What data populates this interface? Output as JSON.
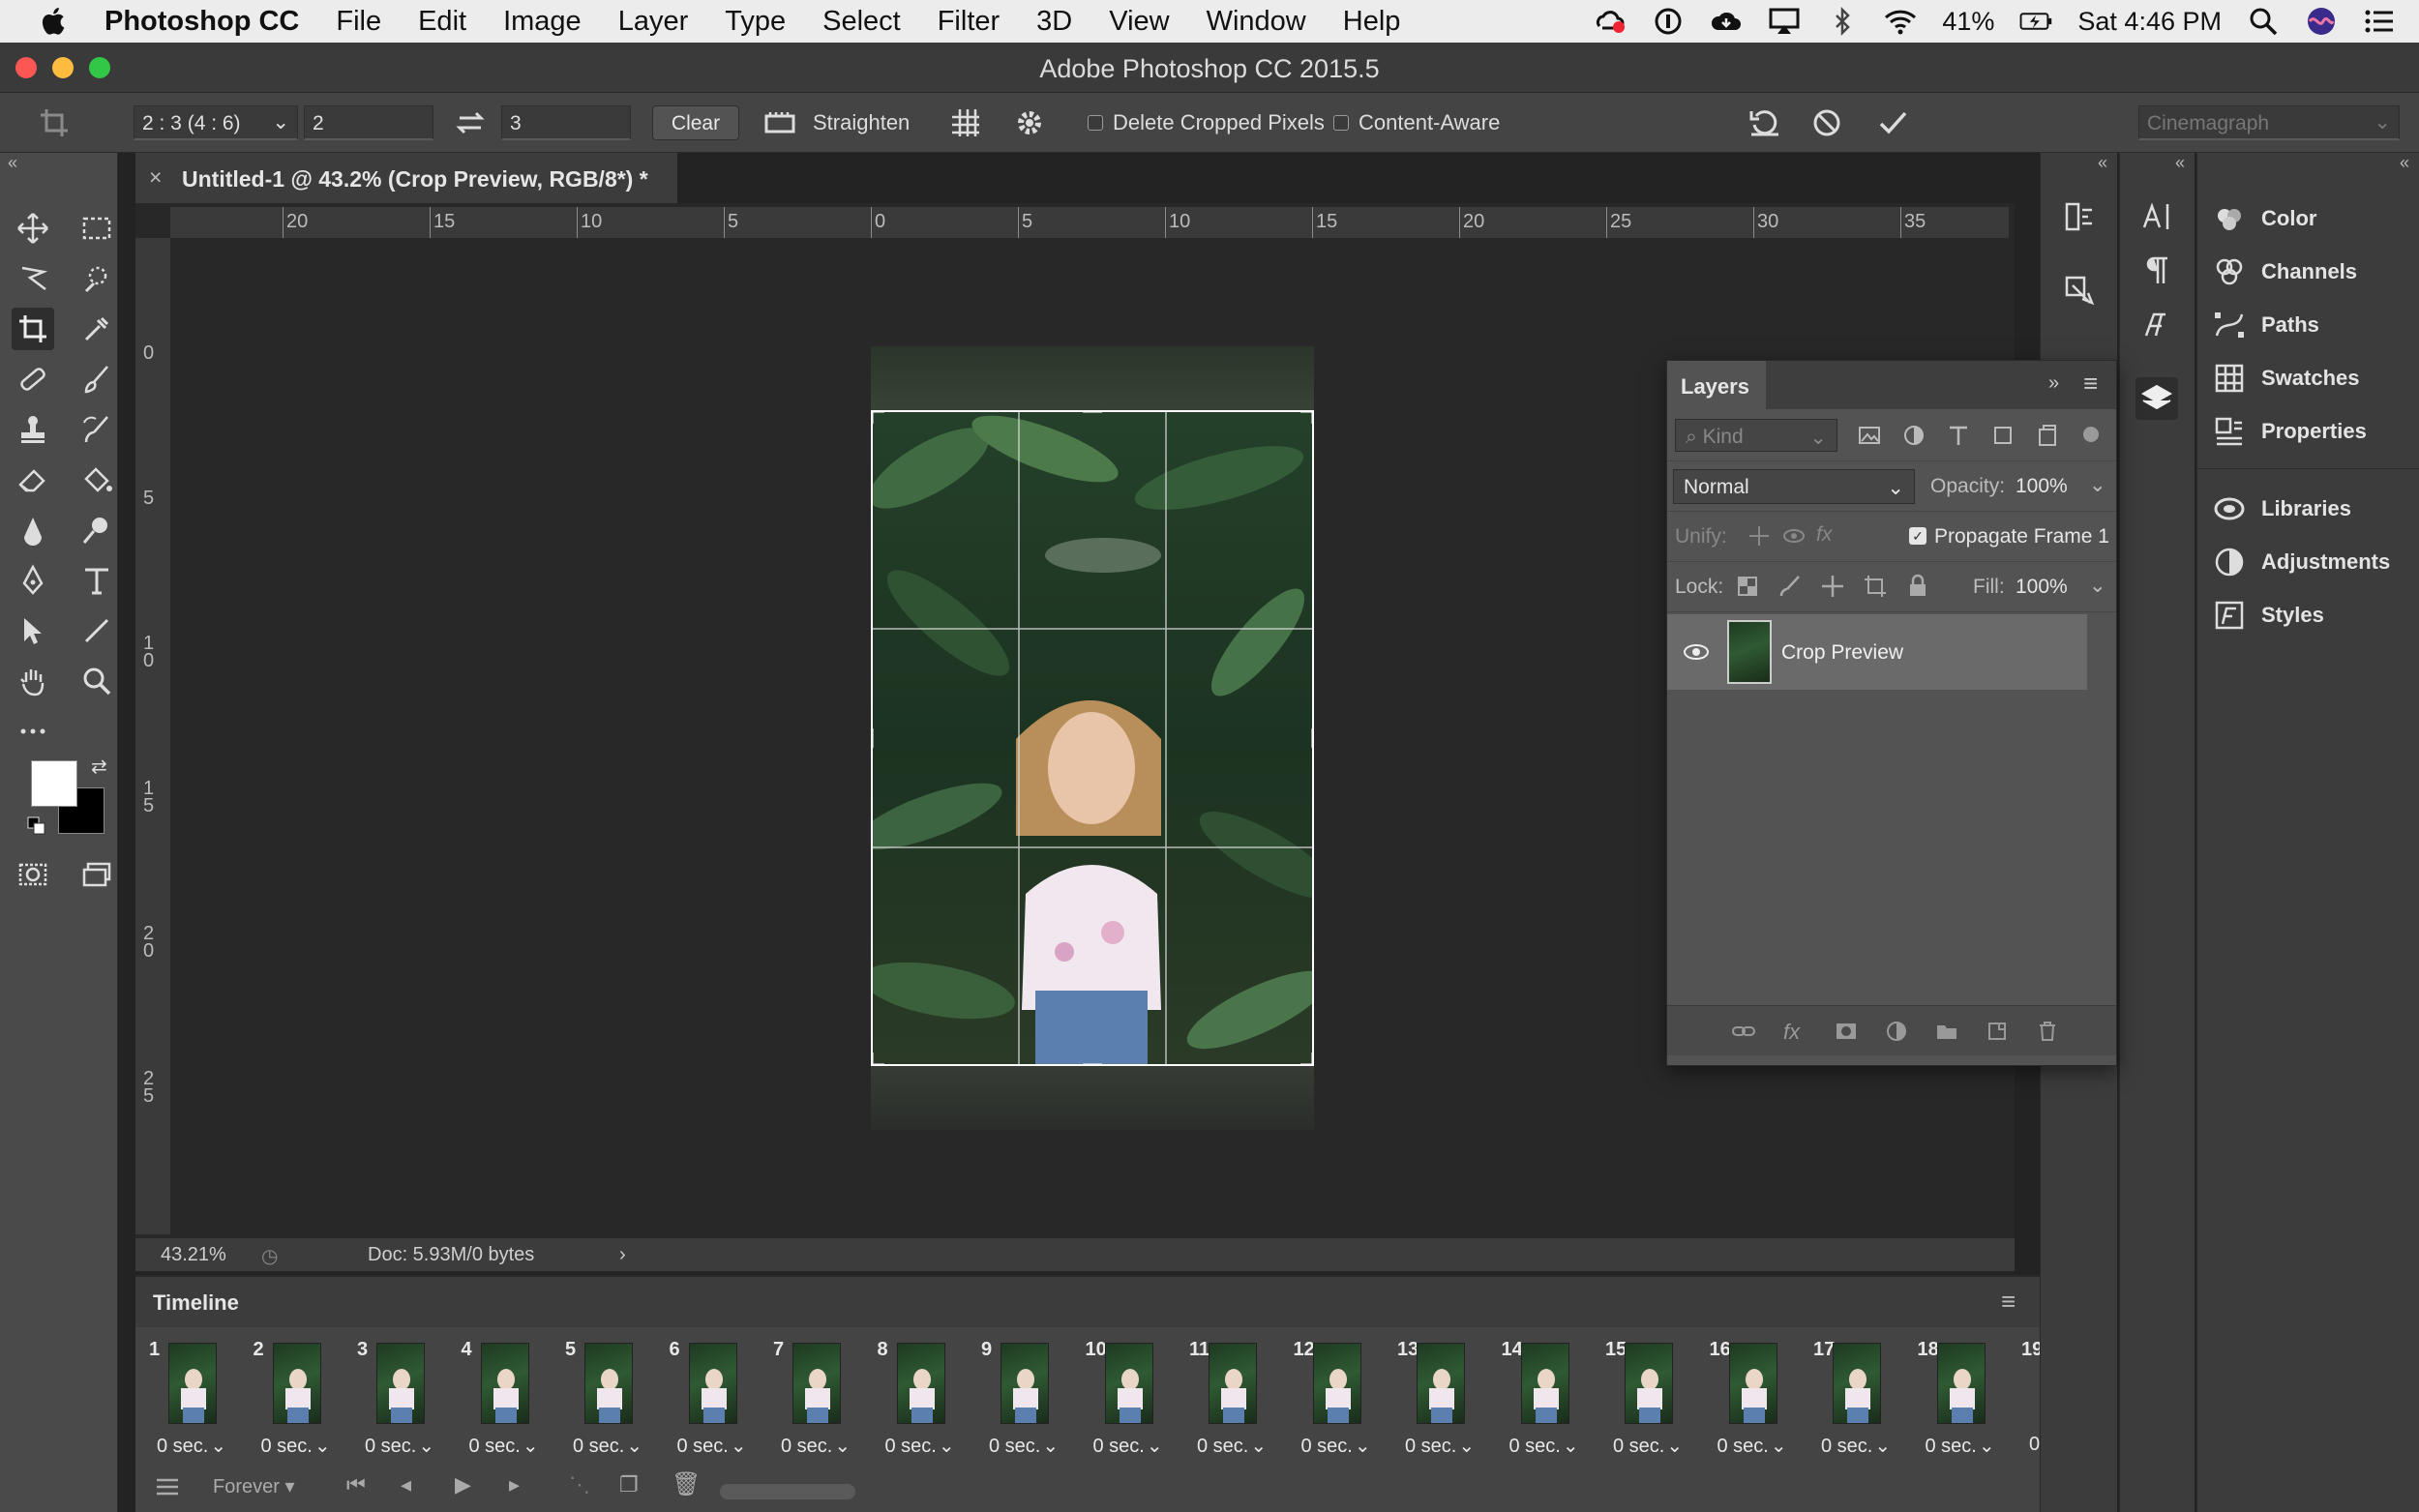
{
  "menubar": {
    "app_name": "Photoshop CC",
    "items": [
      "File",
      "Edit",
      "Image",
      "Layer",
      "Type",
      "Select",
      "Filter",
      "3D",
      "View",
      "Window",
      "Help"
    ],
    "battery": "41%",
    "clock": "Sat 4:46 PM"
  },
  "window": {
    "title": "Adobe Photoshop CC 2015.5"
  },
  "options": {
    "ratio": "2 : 3 (4 : 6)",
    "width_value": "2",
    "height_value": "3",
    "clear_label": "Clear",
    "straighten_label": "Straighten",
    "delete_cropped_label": "Delete Cropped Pixels",
    "content_aware_label": "Content-Aware",
    "workspace": "Cinemagraph"
  },
  "document": {
    "tab_title": "Untitled-1 @ 43.2% (Crop Preview, RGB/8*) *",
    "zoom": "43.21%",
    "doc_info": "Doc: 5.93M/0 bytes"
  },
  "rulers": {
    "top_ticks": [
      "20",
      "15",
      "10",
      "5",
      "0",
      "5",
      "10",
      "15",
      "20",
      "25",
      "30",
      "35"
    ],
    "left_ticks": [
      "0",
      "5",
      "10",
      "15",
      "20",
      "25"
    ]
  },
  "layers_panel": {
    "tab_label": "Layers",
    "kind_placeholder": "Kind",
    "blend_mode": "Normal",
    "opacity_label": "Opacity:",
    "opacity_value": "100%",
    "unify_label": "Unify:",
    "propagate_label": "Propagate Frame 1",
    "lock_label": "Lock:",
    "fill_label": "Fill:",
    "fill_value": "100%",
    "layers": [
      {
        "name": "Crop Preview",
        "visible": true
      }
    ]
  },
  "panel_list": [
    {
      "label": "Color",
      "icon": "color-icon"
    },
    {
      "label": "Channels",
      "icon": "channels-icon"
    },
    {
      "label": "Paths",
      "icon": "paths-icon"
    },
    {
      "label": "Swatches",
      "icon": "swatches-icon"
    },
    {
      "label": "Properties",
      "icon": "properties-icon"
    },
    {
      "label": "Libraries",
      "icon": "libraries-icon"
    },
    {
      "label": "Adjustments",
      "icon": "adjustments-icon"
    },
    {
      "label": "Styles",
      "icon": "styles-icon"
    }
  ],
  "timeline": {
    "title": "Timeline",
    "loop": "Forever",
    "frames": [
      {
        "num": "1",
        "dur": "0 sec."
      },
      {
        "num": "2",
        "dur": "0 sec."
      },
      {
        "num": "3",
        "dur": "0 sec."
      },
      {
        "num": "4",
        "dur": "0 sec."
      },
      {
        "num": "5",
        "dur": "0 sec."
      },
      {
        "num": "6",
        "dur": "0 sec."
      },
      {
        "num": "7",
        "dur": "0 sec."
      },
      {
        "num": "8",
        "dur": "0 sec."
      },
      {
        "num": "9",
        "dur": "0 sec."
      },
      {
        "num": "10",
        "dur": "0 sec."
      },
      {
        "num": "11",
        "dur": "0 sec."
      },
      {
        "num": "12",
        "dur": "0 sec."
      },
      {
        "num": "13",
        "dur": "0 sec."
      },
      {
        "num": "14",
        "dur": "0 sec."
      },
      {
        "num": "15",
        "dur": "0 sec."
      },
      {
        "num": "16",
        "dur": "0 sec."
      },
      {
        "num": "17",
        "dur": "0 sec."
      },
      {
        "num": "18",
        "dur": "0 sec."
      },
      {
        "num": "19",
        "dur": "0"
      }
    ]
  },
  "colors": {
    "foreground": "#ffffff",
    "background": "#000000",
    "accent_red_close": "#fc5753",
    "accent_yellow_min": "#fdbc40",
    "accent_green_max": "#33c748"
  }
}
